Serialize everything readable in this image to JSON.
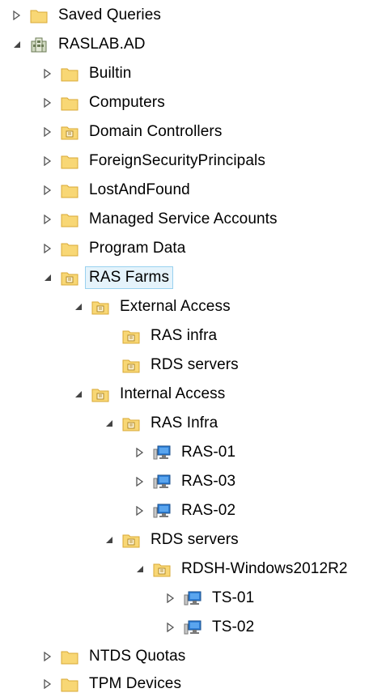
{
  "tree": {
    "saved_queries": "Saved Queries",
    "domain": "RASLAB.AD",
    "builtin": "Builtin",
    "computers": "Computers",
    "domain_controllers": "Domain Controllers",
    "foreign_security_principals": "ForeignSecurityPrincipals",
    "lost_and_found": "LostAndFound",
    "managed_service_accounts": "Managed Service Accounts",
    "program_data": "Program Data",
    "ras_farms": "RAS Farms",
    "external_access": "External Access",
    "external_ras_infra": "RAS infra",
    "external_rds_servers": "RDS servers",
    "internal_access": "Internal Access",
    "internal_ras_infra": "RAS Infra",
    "ras_01": "RAS-01",
    "ras_03": "RAS-03",
    "ras_02": "RAS-02",
    "internal_rds_servers": "RDS servers",
    "rdsh_windows": "RDSH-Windows2012R2",
    "ts_01": "TS-01",
    "ts_02": "TS-02",
    "ntds_quotas": "NTDS Quotas",
    "tpm_devices": "TPM Devices"
  },
  "icons": {
    "folder": "folder-icon",
    "ou": "organizational-unit-icon",
    "domain": "domain-icon",
    "computer": "computer-icon"
  },
  "colors": {
    "folder_fill": "#f8d775",
    "folder_edge": "#d9a835",
    "selection_bg": "#e5f3fb",
    "selection_border": "#99d1ef",
    "computer_screen": "#2f7fd6"
  }
}
